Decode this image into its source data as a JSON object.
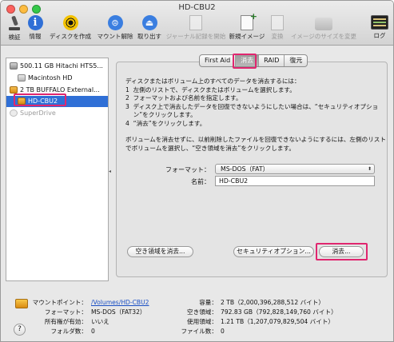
{
  "window": {
    "title": "HD-CBU2"
  },
  "toolbar": {
    "items": [
      {
        "label": "検証",
        "icon": "microscope-icon",
        "enabled": true
      },
      {
        "label": "情報",
        "icon": "info-icon",
        "enabled": true
      },
      {
        "label": "ディスクを作成",
        "icon": "burn-icon",
        "enabled": true
      },
      {
        "label": "マウント解除",
        "icon": "unmount-icon",
        "enabled": true
      },
      {
        "label": "取り出す",
        "icon": "eject-icon",
        "enabled": true
      },
      {
        "label": "ジャーナル記録を開始",
        "icon": "journal-icon",
        "enabled": false
      },
      {
        "label": "新規イメージ",
        "icon": "new-image-icon",
        "enabled": true
      },
      {
        "label": "変換",
        "icon": "convert-icon",
        "enabled": false
      },
      {
        "label": "イメージのサイズを変更",
        "icon": "resize-image-icon",
        "enabled": false
      },
      {
        "label": "ログ",
        "icon": "log-icon",
        "enabled": true
      }
    ]
  },
  "sidebar": {
    "items": [
      {
        "label": "500.11 GB Hitachi HTS5...",
        "kind": "disk"
      },
      {
        "label": "Macintosh HD",
        "kind": "volume"
      },
      {
        "label": "2 TB BUFFALO External...",
        "kind": "external-disk"
      },
      {
        "label": "HD-CBU2",
        "kind": "volume",
        "selected": true
      },
      {
        "label": "SuperDrive",
        "kind": "optical",
        "dim": true
      }
    ]
  },
  "tabs": [
    {
      "label": "First Aid"
    },
    {
      "label": "消去",
      "active": true
    },
    {
      "label": "RAID"
    },
    {
      "label": "復元"
    }
  ],
  "erase": {
    "instructions": [
      "ディスクまたはボリューム上のすべてのデータを消去するには：",
      "1  左側のリストで、ディスクまたはボリュームを選択します。",
      "2  フォーマットおよび名前を指定します。",
      "3  ディスク上で消去したデータを回復できないようにしたい場合は、“セキュリティオプショ",
      "    ン”をクリックします。",
      "4  “消去”をクリックします。"
    ],
    "free_space_note": [
      "ボリュームを消去せずに、以前削除したファイルを回復できないようにするには、左側のリスト",
      "でボリュームを選択し、“空き領域を消去”をクリックします。"
    ],
    "format_label": "フォーマット：",
    "format_value": "MS-DOS（FAT）",
    "name_label": "名前：",
    "name_value": "HD-CBU2",
    "erase_free_space_button": "空き領域を消去...",
    "security_options_button": "セキュリティオプション...",
    "erase_button": "消去..."
  },
  "info": {
    "mount_point_label": "マウントポイント：",
    "mount_point_value": "/Volumes/HD-CBU2",
    "format_label": "フォーマット：",
    "format_value": "MS-DOS（FAT32）",
    "owners_label": "所有権が有効：",
    "owners_value": "いいえ",
    "folders_label": "フォルダ数：",
    "folders_value": "0",
    "capacity_label": "容量：",
    "capacity_value": "2 TB（2,000,396,288,512 バイト）",
    "available_label": "空き領域：",
    "available_value": "792.83 GB（792,828,149,760 バイト）",
    "used_label": "使用領域：",
    "used_value": "1.21 TB（1,207,079,829,504 バイト）",
    "files_label": "ファイル数：",
    "files_value": "0"
  },
  "help_button_label": "?",
  "colors": {
    "selection": "#2f6fd6",
    "highlight_box": "#e0266f",
    "link": "#1a4fc4"
  }
}
